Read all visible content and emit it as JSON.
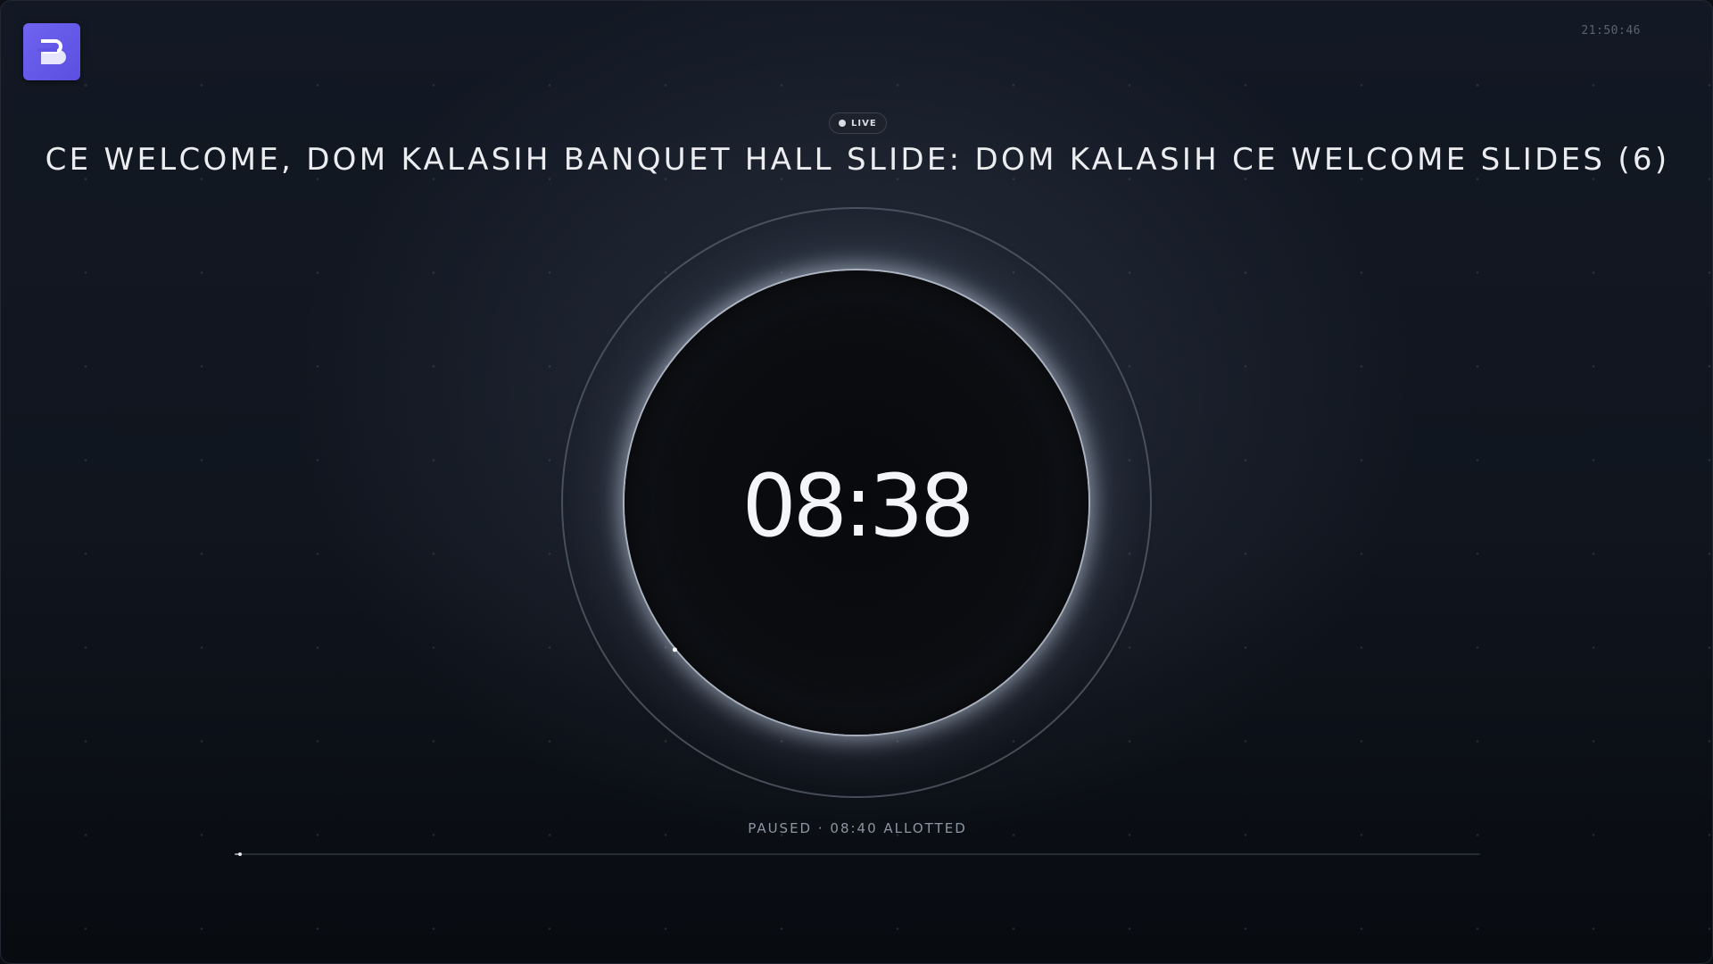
{
  "header": {
    "clock": "21:50:46",
    "live_label": "LIVE",
    "title": "CE WELCOME, DOM KALASIH BANQUET HALL SLIDE: DOM KALASIH CE WELCOME SLIDES (6)"
  },
  "timer": {
    "remaining": "08:38",
    "status": "PAUSED · 08:40 ALLOTTED",
    "progress_fraction": 0.004
  },
  "colors": {
    "logo": "#6059e8",
    "background": "#10151e",
    "text": "#ecedf1"
  },
  "icons": {
    "logo": "brand-logo-icon",
    "live": "live-dot-icon"
  }
}
